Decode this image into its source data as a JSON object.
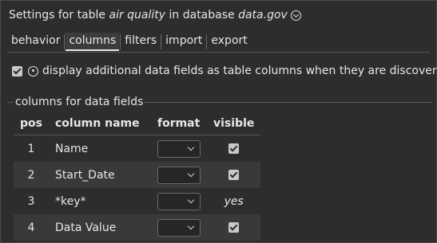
{
  "title": {
    "prefix": "Settings for table",
    "table_name": "air quality",
    "middle": "in database",
    "database_name": "data.gov"
  },
  "tabs": [
    {
      "label": "behavior",
      "active": false
    },
    {
      "label": "columns",
      "active": true
    },
    {
      "label": "filters",
      "active": false
    },
    {
      "label": "import",
      "active": false
    },
    {
      "label": "export",
      "active": false
    }
  ],
  "option": {
    "label": "display additional data fields as table columns when they are discovered",
    "checked": true
  },
  "group": {
    "legend": "columns for data fields",
    "headers": {
      "pos": "pos",
      "column_name": "column name",
      "format": "format",
      "visible": "visible"
    },
    "rows": [
      {
        "pos": "1",
        "name": "Name",
        "format": "",
        "visible": true,
        "visible_text": ""
      },
      {
        "pos": "2",
        "name": "Start_Date",
        "format": "",
        "visible": true,
        "visible_text": ""
      },
      {
        "pos": "3",
        "name": "*key*",
        "format": "",
        "visible": null,
        "visible_text": "yes"
      },
      {
        "pos": "4",
        "name": "Data Value",
        "format": "",
        "visible": true,
        "visible_text": ""
      }
    ]
  },
  "colors": {
    "background": "#2d2d2d",
    "stripe": "#393939",
    "text": "#e6e6e6"
  }
}
